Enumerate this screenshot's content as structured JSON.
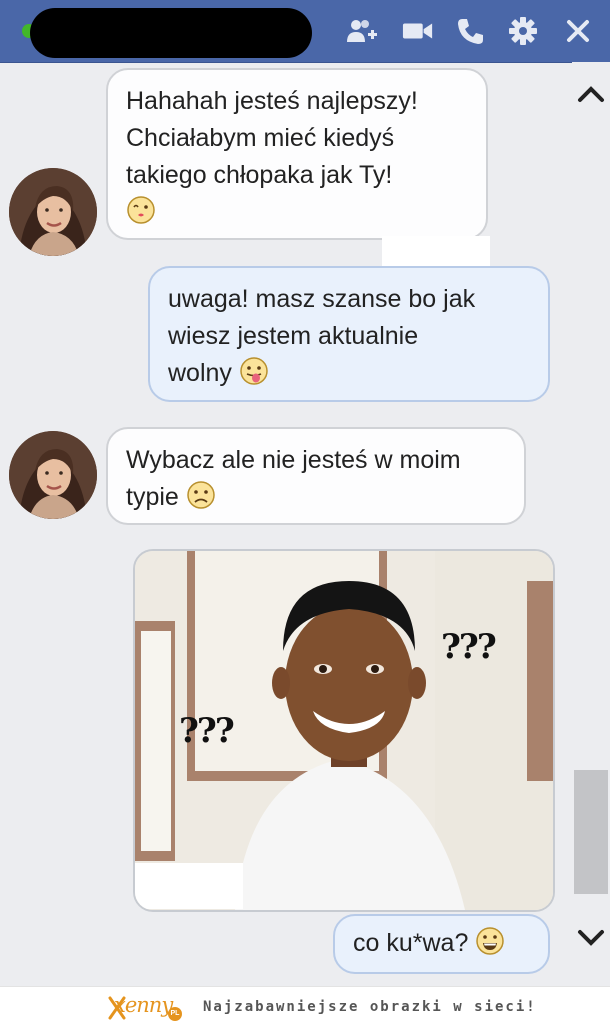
{
  "messages": [
    {
      "side": "in",
      "text": "Hahahah jesteś najlepszy! Chciałabym mieć kiedyś takiego chłopaka jak Ty!",
      "emoji": "kiss-emoji"
    },
    {
      "side": "out",
      "text": "uwaga! masz szanse bo jak wiesz jestem aktualnie wolny",
      "emoji": "tongue-out-emoji"
    },
    {
      "side": "in",
      "text": "Wybacz ale nie jesteś w moim typie",
      "emoji": "sad-emoji"
    },
    {
      "side": "out",
      "type": "image",
      "image_text": [
        "???",
        "???"
      ]
    },
    {
      "side": "out",
      "text": "co ku*wa?",
      "emoji": "grin-emoji"
    }
  ],
  "m1": {
    "line1": "Hahahah jesteś najlepszy!",
    "line2": "Chciałabym mieć kiedyś",
    "line3": "takiego chłopaka jak Ty!"
  },
  "m2": {
    "line1": "uwaga! masz szanse bo jak",
    "line2": "wiesz jestem aktualnie",
    "line3": "wolny"
  },
  "m3": {
    "line1": "Wybacz ale nie jesteś w moim",
    "line2": "typie"
  },
  "m4": {
    "qm_left": "???",
    "qm_right": "???"
  },
  "m5": {
    "line1": "co ku*wa?"
  },
  "header": {
    "icons": [
      "add-friend-icon",
      "video-call-icon",
      "phone-icon",
      "gear-icon",
      "close-icon"
    ]
  },
  "footer": {
    "logo": "xenny",
    "logo_suffix": "PL",
    "tagline": "Najzabawniejsze obrazki w sieci!"
  },
  "colors": {
    "header": "#4a67a8",
    "online": "#42b72a",
    "out_bubble": "#e9f1fc",
    "in_bubble": "#fdfdfe"
  }
}
